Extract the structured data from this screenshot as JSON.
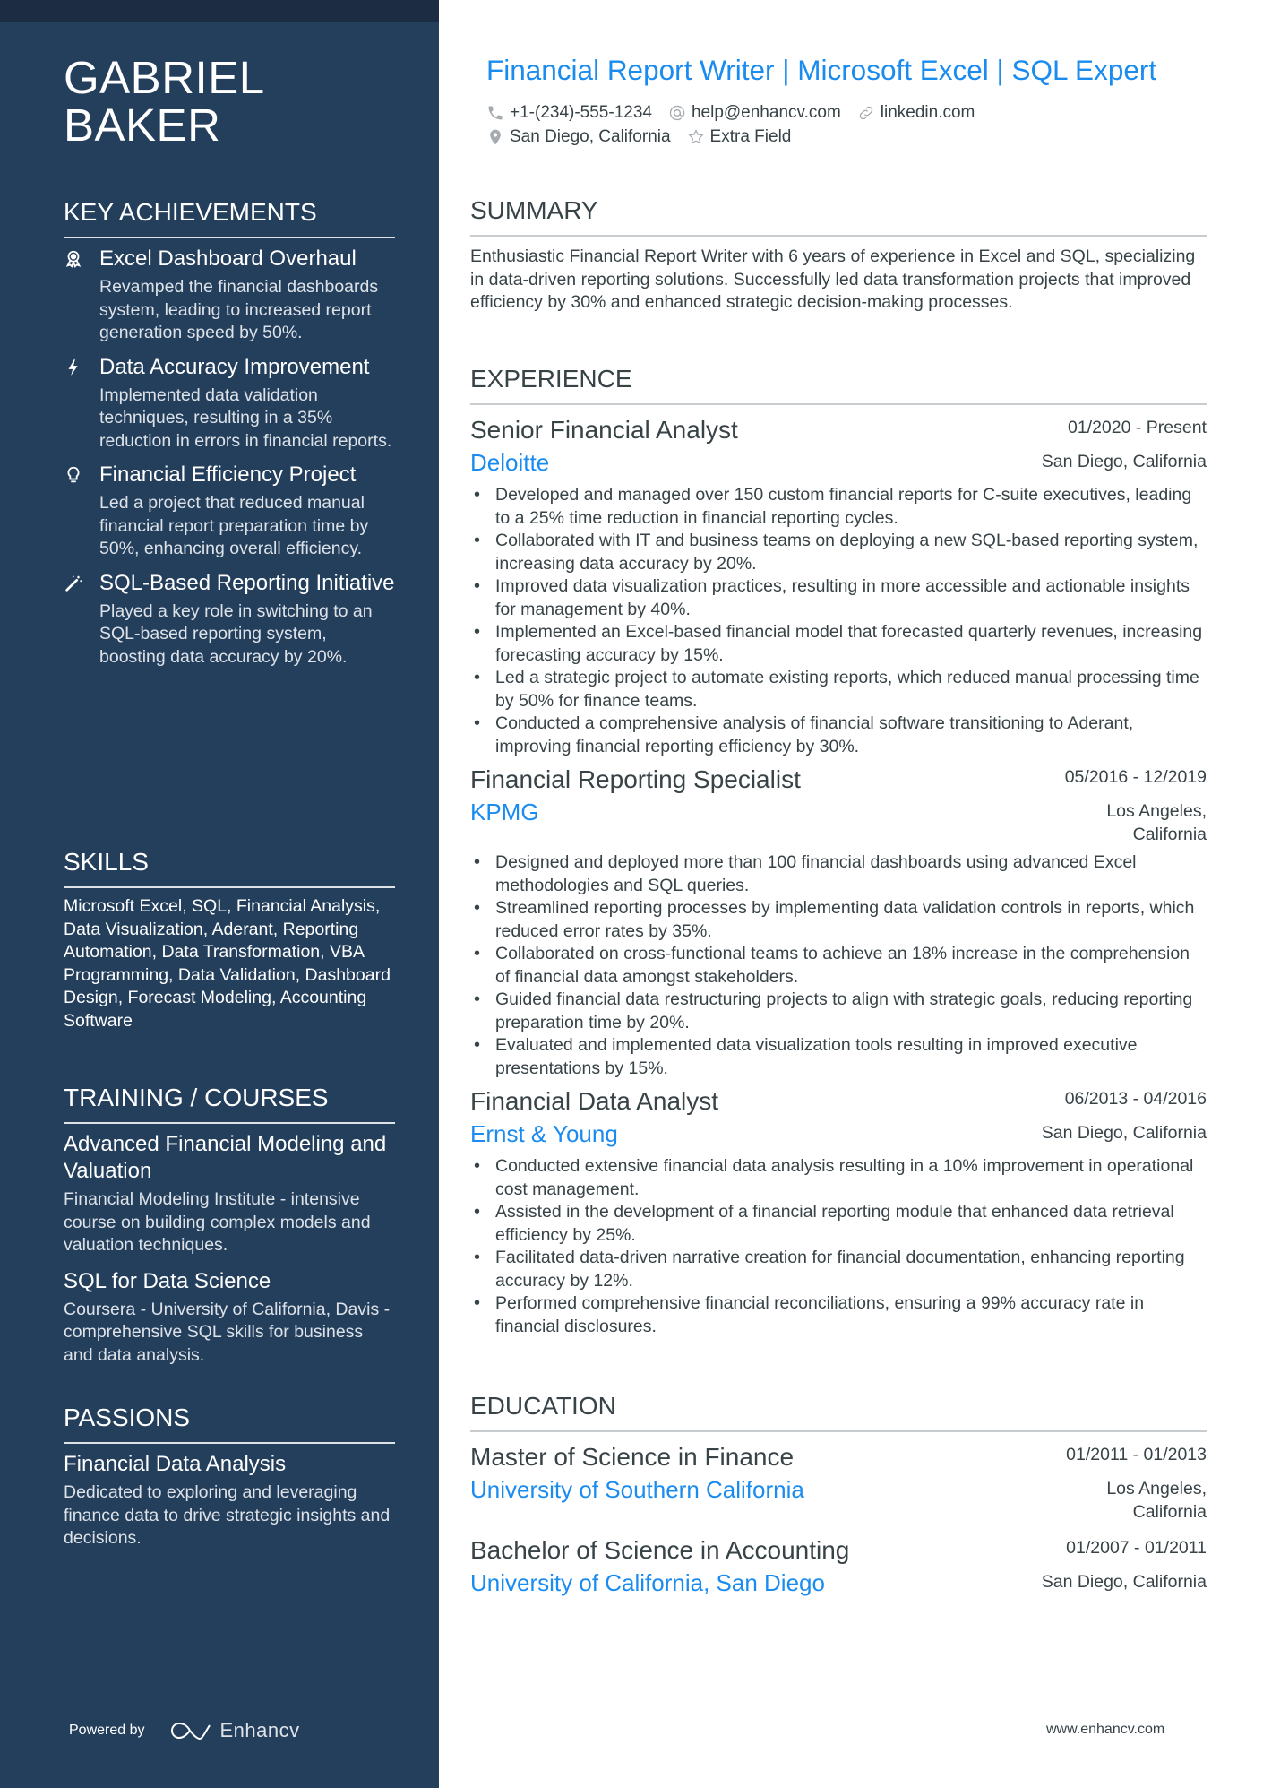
{
  "person": {
    "name_line1": "GABRIEL",
    "name_line2": "BAKER",
    "headline": "Financial Report Writer | Microsoft Excel | SQL Expert",
    "contacts": {
      "phone": "+1-(234)-555-1234",
      "email": "help@enhancv.com",
      "linkedin": "linkedin.com",
      "location": "San Diego, California",
      "extra": "Extra Field"
    }
  },
  "sidebar": {
    "key_achievements": {
      "title": "KEY ACHIEVEMENTS",
      "items": [
        {
          "icon": "award-ribbon-icon",
          "title": "Excel Dashboard Overhaul",
          "description": "Revamped the financial dashboards system, leading to increased report generation speed by 50%."
        },
        {
          "icon": "lightning-bolt-icon",
          "title": "Data Accuracy Improvement",
          "description": "Implemented data validation techniques, resulting in a 35% reduction in errors in financial reports."
        },
        {
          "icon": "lightbulb-icon",
          "title": "Financial Efficiency Project",
          "description": "Led a project that reduced manual financial report preparation time by 50%, enhancing overall efficiency."
        },
        {
          "icon": "magic-wand-icon",
          "title": "SQL-Based Reporting Initiative",
          "description": "Played a key role in switching to an SQL-based reporting system, boosting data accuracy by 20%."
        }
      ]
    },
    "skills": {
      "title": "SKILLS",
      "text": "Microsoft Excel, SQL, Financial Analysis, Data Visualization, Aderant, Reporting Automation, Data Transformation, VBA Programming, Data Validation, Dashboard Design, Forecast Modeling, Accounting Software"
    },
    "training": {
      "title": "TRAINING / COURSES",
      "items": [
        {
          "title": "Advanced Financial Modeling and Valuation",
          "description": "Financial Modeling Institute - intensive course on building complex models and valuation techniques."
        },
        {
          "title": "SQL for Data Science",
          "description": "Coursera - University of California, Davis - comprehensive SQL skills for business and data analysis."
        }
      ]
    },
    "passions": {
      "title": "PASSIONS",
      "items": [
        {
          "title": "Financial Data Analysis",
          "description": "Dedicated to exploring and leveraging finance data to drive strategic insights and decisions."
        }
      ]
    },
    "footer": {
      "powered_by": "Powered by",
      "brand": "Enhancv"
    }
  },
  "main": {
    "summary": {
      "title": "SUMMARY",
      "text": "Enthusiastic Financial Report Writer with 6 years of experience in Excel and SQL, specializing in data-driven reporting solutions. Successfully led data transformation projects that improved efficiency by 30% and enhanced strategic decision-making processes."
    },
    "experience": {
      "title": "EXPERIENCE",
      "jobs": [
        {
          "title": "Senior Financial Analyst",
          "dates": "01/2020 - Present",
          "company": "Deloitte",
          "location": "San Diego, California",
          "bullets": [
            "Developed and managed over 150 custom financial reports for C-suite executives, leading to a 25% time reduction in financial reporting cycles.",
            "Collaborated with IT and business teams on deploying a new SQL-based reporting system, increasing data accuracy by 20%.",
            "Improved data visualization practices, resulting in more accessible and actionable insights for management by 40%.",
            "Implemented an Excel-based financial model that forecasted quarterly revenues, increasing forecasting accuracy by 15%.",
            "Led a strategic project to automate existing reports, which reduced manual processing time by 50% for finance teams.",
            "Conducted a comprehensive analysis of financial software transitioning to Aderant, improving financial reporting efficiency by 30%."
          ]
        },
        {
          "title": "Financial Reporting Specialist",
          "dates": "05/2016 - 12/2019",
          "company": "KPMG",
          "location": "Los Angeles, California",
          "bullets": [
            "Designed and deployed more than 100 financial dashboards using advanced Excel methodologies and SQL queries.",
            "Streamlined reporting processes by implementing data validation controls in reports, which reduced error rates by 35%.",
            "Collaborated on cross-functional teams to achieve an 18% increase in the comprehension of financial data amongst stakeholders.",
            "Guided financial data restructuring projects to align with strategic goals, reducing reporting preparation time by 20%.",
            "Evaluated and implemented data visualization tools resulting in improved executive presentations by 15%."
          ]
        },
        {
          "title": "Financial Data Analyst",
          "dates": "06/2013 - 04/2016",
          "company": "Ernst & Young",
          "location": "San Diego, California",
          "bullets": [
            "Conducted extensive financial data analysis resulting in a 10% improvement in operational cost management.",
            "Assisted in the development of a financial reporting module that enhanced data retrieval efficiency by 25%.",
            "Facilitated data-driven narrative creation for financial documentation, enhancing reporting accuracy by 12%.",
            "Performed comprehensive financial reconciliations, ensuring a 99% accuracy rate in financial disclosures."
          ]
        }
      ]
    },
    "education": {
      "title": "EDUCATION",
      "items": [
        {
          "degree": "Master of Science in Finance",
          "dates": "01/2011 - 01/2013",
          "school": "University of Southern California",
          "location": "Los Angeles, California"
        },
        {
          "degree": "Bachelor of Science in Accounting",
          "dates": "01/2007 - 01/2011",
          "school": "University of California, San Diego",
          "location": "San Diego, California"
        }
      ]
    },
    "footer_url": "www.enhancv.com"
  },
  "colors": {
    "sidebar_bg": "#243f5c",
    "sidebar_topbar": "#1c2d43",
    "accent": "#1a8cf0",
    "text": "#384347"
  }
}
